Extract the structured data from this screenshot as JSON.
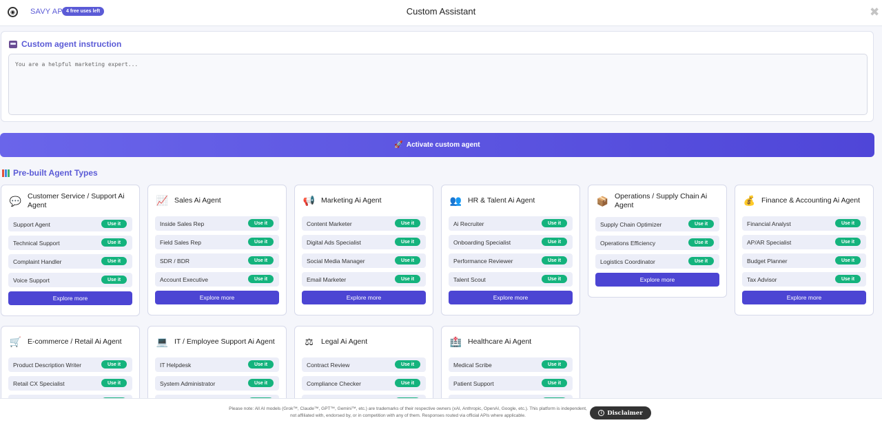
{
  "header": {
    "brand": "SAVY APT",
    "uses_badge": "4 free uses left",
    "title": "Custom Assistant",
    "close_glyph": "✖"
  },
  "instruction": {
    "heading": "Custom agent instruction",
    "placeholder": "You are a helpful marketing expert..."
  },
  "activate": {
    "label": "Activate custom agent"
  },
  "prebuilt": {
    "heading": "Pre-built Agent Types",
    "use_label": "Use it",
    "explore_label": "Explore more",
    "cards": [
      {
        "title": "Customer Service / Support Ai Agent",
        "icon": "speech-bubble-icon",
        "roles": [
          "Support Agent",
          "Technical Support",
          "Complaint Handler",
          "Voice Support"
        ]
      },
      {
        "title": "Sales Ai Agent",
        "icon": "chart-increasing-icon",
        "roles": [
          "Inside Sales Rep",
          "Field Sales Rep",
          "SDR / BDR",
          "Account Executive"
        ]
      },
      {
        "title": "Marketing Ai Agent",
        "icon": "megaphone-icon",
        "roles": [
          "Content Marketer",
          "Digital Ads Specialist",
          "Social Media Manager",
          "Email Marketer"
        ]
      },
      {
        "title": "HR & Talent Ai Agent",
        "icon": "people-icon",
        "roles": [
          "Ai Recruiter",
          "Onboarding Specialist",
          "Performance Reviewer",
          "Talent Scout"
        ]
      },
      {
        "title": "Operations / Supply Chain Ai Agent",
        "icon": "package-icon",
        "roles": [
          "Supply Chain Optimizer",
          "Operations Efficiency",
          "Logistics Coordinator"
        ]
      },
      {
        "title": "Finance & Accounting Ai Agent",
        "icon": "money-bag-icon",
        "roles": [
          "Financial Analyst",
          "AP/AR Specialist",
          "Budget Planner",
          "Tax Advisor"
        ]
      },
      {
        "title": "E-commerce / Retail Ai Agent",
        "icon": "shopping-cart-icon",
        "roles": [
          "Product Description Writer",
          "Retail CX Specialist",
          ""
        ]
      },
      {
        "title": "IT / Employee Support Ai Agent",
        "icon": "computer-icon",
        "roles": [
          "IT Helpdesk",
          "System Administrator",
          ""
        ]
      },
      {
        "title": "Legal Ai Agent",
        "icon": "scales-icon",
        "roles": [
          "Contract Review",
          "Compliance Checker",
          ""
        ]
      },
      {
        "title": "Healthcare Ai Agent",
        "icon": "hospital-icon",
        "roles": [
          "Medical Scribe",
          "Patient Support",
          ""
        ]
      }
    ]
  },
  "footer": {
    "note": "Please note: All AI models (Grok™, Claude™, GPT™, Gemini™, etc.) are trademarks of their respective owners (xAI, Anthropic, OpenAI, Google, etc.). This platform is independent, not affiliated with, endorsed by, or in competition with any of them. Responses routed via official APIs where applicable.",
    "disclaimer_label": "Disclaimer"
  }
}
